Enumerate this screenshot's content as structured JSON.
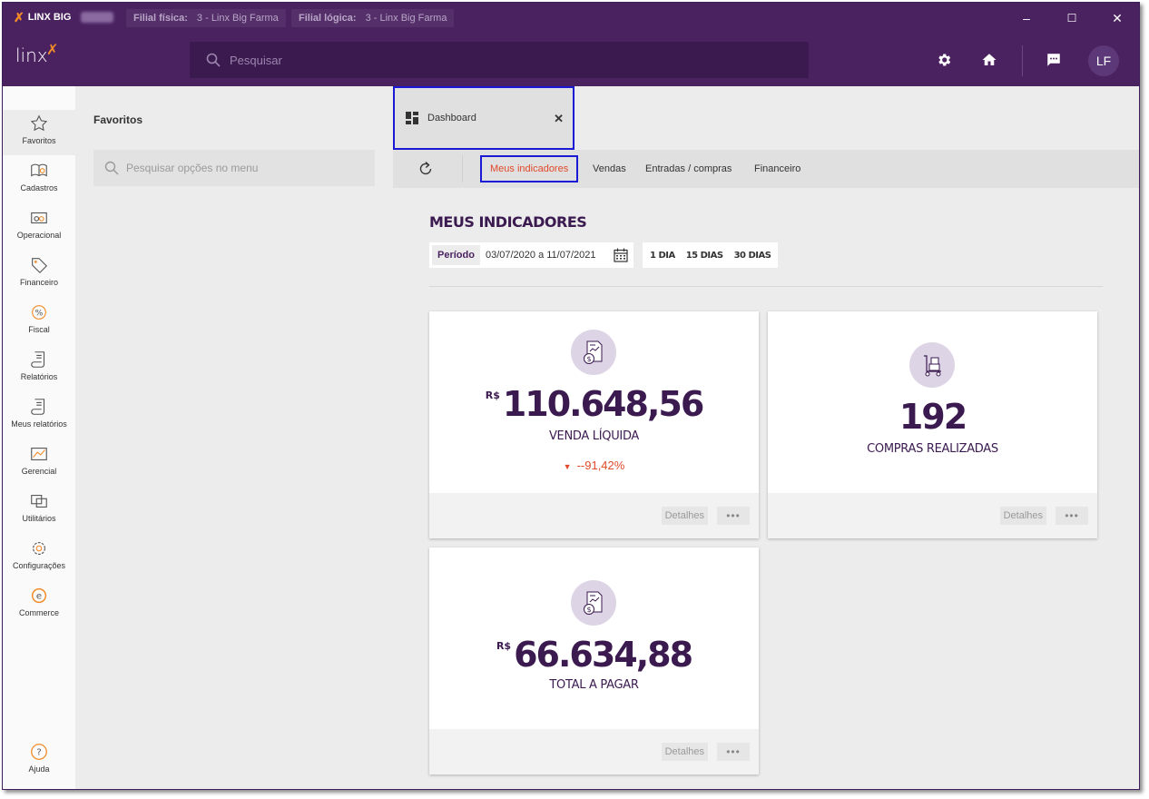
{
  "titlebar": {
    "app_name": "LINX BIG",
    "filial_fisica_label": "Filial física:",
    "filial_fisica_value": "3 - Linx Big Farma",
    "filial_logica_label": "Filial lógica:",
    "filial_logica_value": "3 - Linx Big Farma",
    "minimize": "–",
    "maximize": "☐",
    "close": "✕"
  },
  "header": {
    "logo": "linx",
    "search_placeholder": "Pesquisar",
    "avatar_initials": "LF"
  },
  "leftnav": {
    "items": [
      {
        "label": "Favoritos",
        "icon": "star-icon"
      },
      {
        "label": "Cadastros",
        "icon": "book-icon"
      },
      {
        "label": "Operacional",
        "icon": "cash-icon"
      },
      {
        "label": "Financeiro",
        "icon": "tag-icon"
      },
      {
        "label": "Fiscal",
        "icon": "percent-icon"
      },
      {
        "label": "Relatórios",
        "icon": "scroll-icon"
      },
      {
        "label": "Meus relatórios",
        "icon": "scroll-icon"
      },
      {
        "label": "Gerencial",
        "icon": "chart-icon"
      },
      {
        "label": "Utilitários",
        "icon": "windows-icon"
      },
      {
        "label": "Configurações",
        "icon": "gear-icon"
      },
      {
        "label": "Commerce",
        "icon": "commerce-icon"
      }
    ],
    "help_label": "Ajuda"
  },
  "favorites": {
    "title": "Favoritos",
    "search_placeholder": "Pesquisar opções no menu"
  },
  "main": {
    "tab_label": "Dashboard",
    "subtabs": [
      "Meus indicadores",
      "Vendas",
      "Entradas / compras",
      "Financeiro"
    ],
    "page_title": "MEUS INDICADORES",
    "period_label": "Período",
    "period_value": "03/07/2020 a 11/07/2021",
    "quick_ranges": [
      "1 DIA",
      "15 DIAS",
      "30 DIAS"
    ],
    "cards": [
      {
        "currency": "R$",
        "value": "110.648,56",
        "label": "VENDA LÍQUIDA",
        "delta": "--91,42%",
        "details": "Detalhes",
        "more": "•••"
      },
      {
        "currency": "",
        "value": "192",
        "label": "COMPRAS REALIZADAS",
        "details": "Detalhes",
        "more": "•••"
      },
      {
        "currency": "R$",
        "value": "66.634,88",
        "label": "TOTAL A PAGAR",
        "details": "Detalhes",
        "more": "•••"
      }
    ]
  },
  "colors": {
    "brand_purple": "#4a2260",
    "accent_orange": "#f28b28",
    "active_red": "#e0492a",
    "highlight_blue": "#1a1ad6"
  }
}
